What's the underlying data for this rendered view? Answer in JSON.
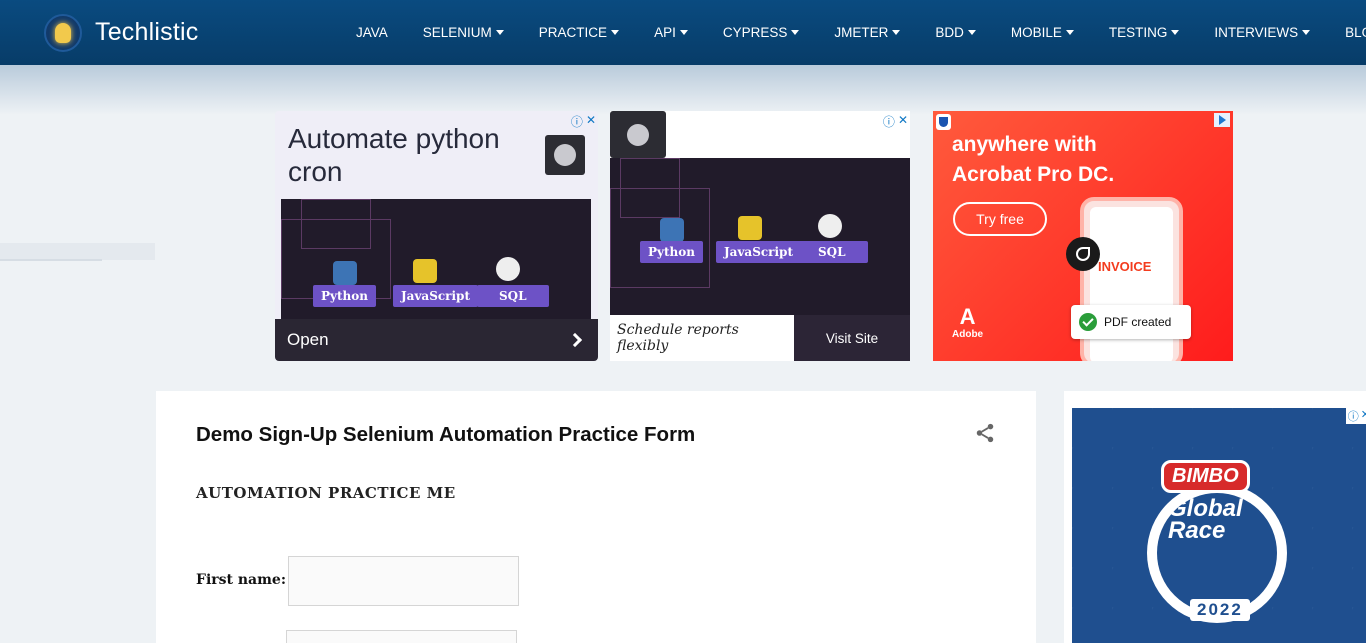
{
  "header": {
    "brand": "Techlistic",
    "nav": [
      {
        "label": "JAVA",
        "dropdown": false
      },
      {
        "label": "SELENIUM",
        "dropdown": true
      },
      {
        "label": "PRACTICE",
        "dropdown": true
      },
      {
        "label": "API",
        "dropdown": true
      },
      {
        "label": "CYPRESS",
        "dropdown": true
      },
      {
        "label": "JMETER",
        "dropdown": true
      },
      {
        "label": "BDD",
        "dropdown": true
      },
      {
        "label": "MOBILE",
        "dropdown": true
      },
      {
        "label": "TESTING",
        "dropdown": true
      },
      {
        "label": "INTERVIEWS",
        "dropdown": true
      },
      {
        "label": "BLOGS",
        "dropdown": false
      }
    ]
  },
  "ads": {
    "ad1": {
      "headline": "Automate python cron",
      "cta": "Open",
      "chips": [
        "Python",
        "JavaScript",
        "SQL"
      ]
    },
    "ad2": {
      "tagline": "Schedule reports flexibly",
      "cta": "Visit Site",
      "chips": [
        "Python",
        "JavaScript",
        "SQL"
      ]
    },
    "ad3": {
      "headline": "anywhere with Acrobat Pro DC.",
      "cta": "Try free",
      "invoice": "INVOICE",
      "badge": "PDF created",
      "brand": "Adobe"
    },
    "side": {
      "brand": "BIMBO",
      "event": "Global Race",
      "year": "2022"
    }
  },
  "post": {
    "title": "Demo Sign-Up Selenium Automation Practice Form",
    "subtitle": "AUTOMATION PRACTICE ME",
    "first_name_label": "First name:"
  },
  "colors": {
    "header": "#0a4b80",
    "background": "#eef2f5",
    "chip": "#6d52c6",
    "acrobat_red": "#ff1c1c"
  }
}
